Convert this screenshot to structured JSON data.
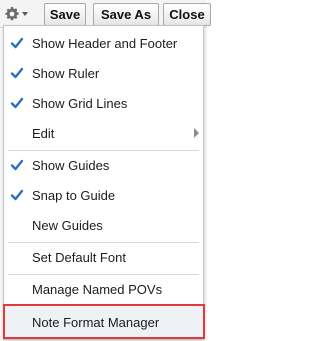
{
  "toolbar": {
    "gear_icon": "gear-icon",
    "save_label": "Save",
    "save_as_label": "Save As",
    "close_label": "Close"
  },
  "menu": {
    "check_color": "#2a6fc4",
    "highlight_color": "#e03a3a",
    "items": [
      {
        "label": "Show Header and Footer",
        "checked": true
      },
      {
        "label": "Show Ruler",
        "checked": true
      },
      {
        "label": "Show Grid Lines",
        "checked": true
      },
      {
        "label": "Edit",
        "checked": false,
        "submenu": true
      },
      {
        "label": "Show Guides",
        "checked": true
      },
      {
        "label": "Snap to Guide",
        "checked": true
      },
      {
        "label": "New Guides",
        "checked": false
      },
      {
        "label": "Set Default Font",
        "checked": false
      },
      {
        "label": "Manage Named POVs",
        "checked": false
      },
      {
        "label": "Note Format Manager",
        "checked": false,
        "highlighted": true
      }
    ]
  }
}
